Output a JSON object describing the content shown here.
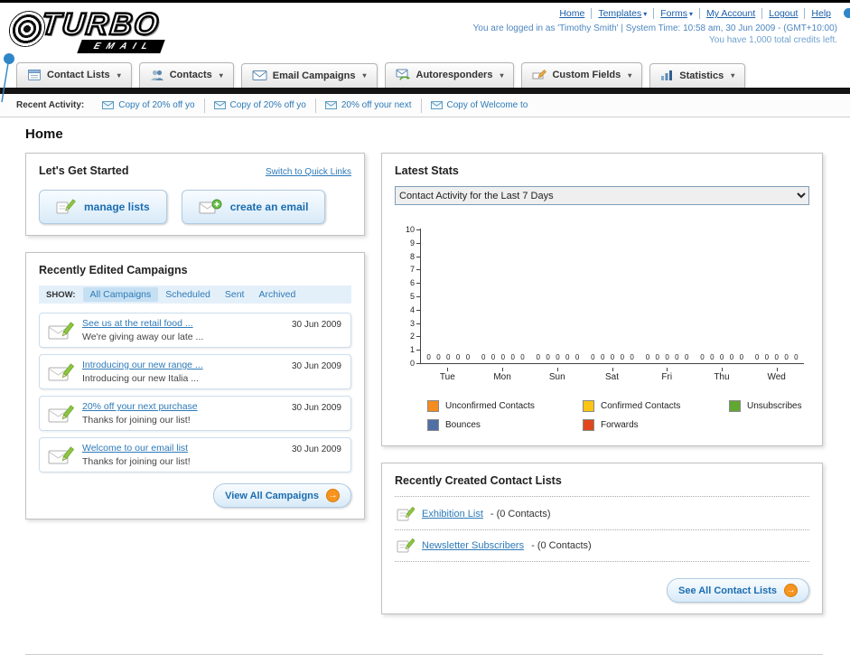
{
  "header": {
    "logo_primary": "TURBO",
    "logo_secondary": "EMAIL",
    "links": [
      {
        "label": "Home",
        "caret": false
      },
      {
        "label": "Templates",
        "caret": true
      },
      {
        "label": "Forms",
        "caret": true
      },
      {
        "label": "My Account",
        "caret": false
      },
      {
        "label": "Logout",
        "caret": false
      },
      {
        "label": "Help",
        "caret": false
      }
    ],
    "login_info": "You are logged in as 'Timothy Smith' | System Time: 10:58 am, 30 Jun 2009 - (GMT+10:00)",
    "credits": "You have 1,000 total credits left."
  },
  "nav": {
    "tabs": [
      {
        "label": "Contact Lists",
        "icon": "contact-lists"
      },
      {
        "label": "Contacts",
        "icon": "contacts"
      },
      {
        "label": "Email Campaigns",
        "icon": "email-campaigns"
      },
      {
        "label": "Autoresponders",
        "icon": "autoresponders"
      },
      {
        "label": "Custom Fields",
        "icon": "custom-fields"
      },
      {
        "label": "Statistics",
        "icon": "statistics"
      }
    ]
  },
  "recent_activity": {
    "label": "Recent Activity:",
    "items": [
      "Copy of 20% off yo",
      "Copy of 20% off yo",
      "20% off your next",
      "Copy of Welcome to"
    ]
  },
  "page_title": "Home",
  "get_started": {
    "title": "Let's Get Started",
    "switch_link": "Switch to Quick Links",
    "buttons": [
      {
        "label": "manage lists",
        "icon": "pencil"
      },
      {
        "label": "create an email",
        "icon": "envelope-plus"
      }
    ]
  },
  "campaigns": {
    "title": "Recently Edited Campaigns",
    "show_label": "SHOW:",
    "filters": [
      "All Campaigns",
      "Scheduled",
      "Sent",
      "Archived"
    ],
    "active_filter": "All Campaigns",
    "items": [
      {
        "title": "See us at the retail food ...",
        "subtitle": "We're giving away our late ...",
        "date": "30 Jun 2009"
      },
      {
        "title": "Introducing our new range ...",
        "subtitle": "Introducing our new Italia ...",
        "date": "30 Jun 2009"
      },
      {
        "title": "20% off your next purchase",
        "subtitle": "Thanks for joining our list!",
        "date": "30 Jun 2009"
      },
      {
        "title": "Welcome to our email list",
        "subtitle": "Thanks for joining our list!",
        "date": "30 Jun 2009"
      }
    ],
    "view_all_label": "View All Campaigns"
  },
  "stats": {
    "title": "Latest Stats",
    "dropdown_value": "Contact Activity for the Last 7 Days"
  },
  "chart_data": {
    "type": "bar",
    "title": "Contact Activity for the Last 7 Days",
    "categories": [
      "Tue",
      "Mon",
      "Sun",
      "Sat",
      "Fri",
      "Thu",
      "Wed"
    ],
    "series": [
      {
        "name": "Unconfirmed Contacts",
        "color": "#f68b1f",
        "values": [
          0,
          0,
          0,
          0,
          0,
          0,
          0
        ]
      },
      {
        "name": "Confirmed Contacts",
        "color": "#fdc513",
        "values": [
          0,
          0,
          0,
          0,
          0,
          0,
          0
        ]
      },
      {
        "name": "Unsubscribes",
        "color": "#61a831",
        "values": [
          0,
          0,
          0,
          0,
          0,
          0,
          0
        ]
      },
      {
        "name": "Bounces",
        "color": "#4f6fa5",
        "values": [
          0,
          0,
          0,
          0,
          0,
          0,
          0
        ]
      },
      {
        "name": "Forwards",
        "color": "#e0471e",
        "values": [
          0,
          0,
          0,
          0,
          0,
          0,
          0
        ]
      }
    ],
    "ylim": [
      0,
      10
    ],
    "yticks": [
      0,
      1,
      2,
      3,
      4,
      5,
      6,
      7,
      8,
      9,
      10
    ],
    "xlabel": "",
    "ylabel": "",
    "grid": false,
    "legend_position": "bottom"
  },
  "contact_lists": {
    "title": "Recently Created Contact Lists",
    "items": [
      {
        "name": "Exhibition List",
        "suffix": "- (0 Contacts)"
      },
      {
        "name": "Newsletter Subscribers",
        "suffix": "- (0 Contacts)"
      }
    ],
    "see_all_label": "See All Contact Lists"
  }
}
